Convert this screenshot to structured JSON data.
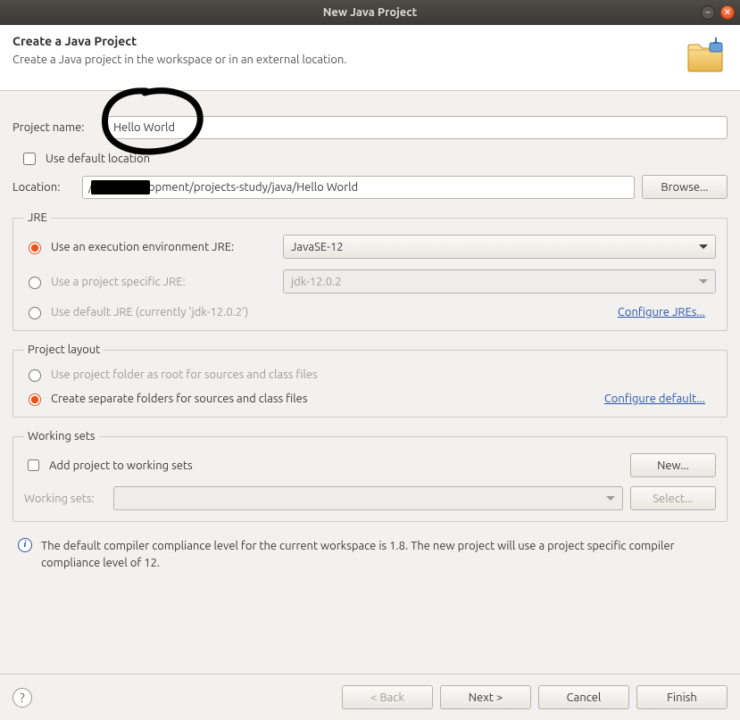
{
  "window": {
    "title": "New Java Project"
  },
  "header": {
    "title": "Create a Java Project",
    "subtitle": "Create a Java project in the workspace or in an external location."
  },
  "project_name": {
    "label": "Project name:",
    "value": "Hello World"
  },
  "use_default_location": {
    "label": "Use default location",
    "checked": false
  },
  "location": {
    "label": "Location:",
    "value": "/home/evelopment/projects-study/java/Hello World",
    "browse": "Browse..."
  },
  "jre": {
    "legend": "JRE",
    "opt_env": {
      "label": "Use an execution environment JRE:",
      "selected": "JavaSE-12"
    },
    "opt_project": {
      "label": "Use a project specific JRE:",
      "selected": "jdk-12.0.2"
    },
    "opt_default": {
      "label": "Use default JRE (currently 'jdk-12.0.2')"
    },
    "configure": "Configure JREs..."
  },
  "layout": {
    "legend": "Project layout",
    "opt_root": "Use project folder as root for sources and class files",
    "opt_separate": "Create separate folders for sources and class files",
    "configure": "Configure default..."
  },
  "working_sets": {
    "legend": "Working sets",
    "add_label": "Add project to working sets",
    "new_btn": "New...",
    "label": "Working sets:",
    "select_btn": "Select..."
  },
  "info_text": "The default compiler compliance level for the current workspace is 1.8. The new project will use a project specific compiler compliance level of 12.",
  "footer": {
    "back": "< Back",
    "next": "Next >",
    "cancel": "Cancel",
    "finish": "Finish"
  }
}
